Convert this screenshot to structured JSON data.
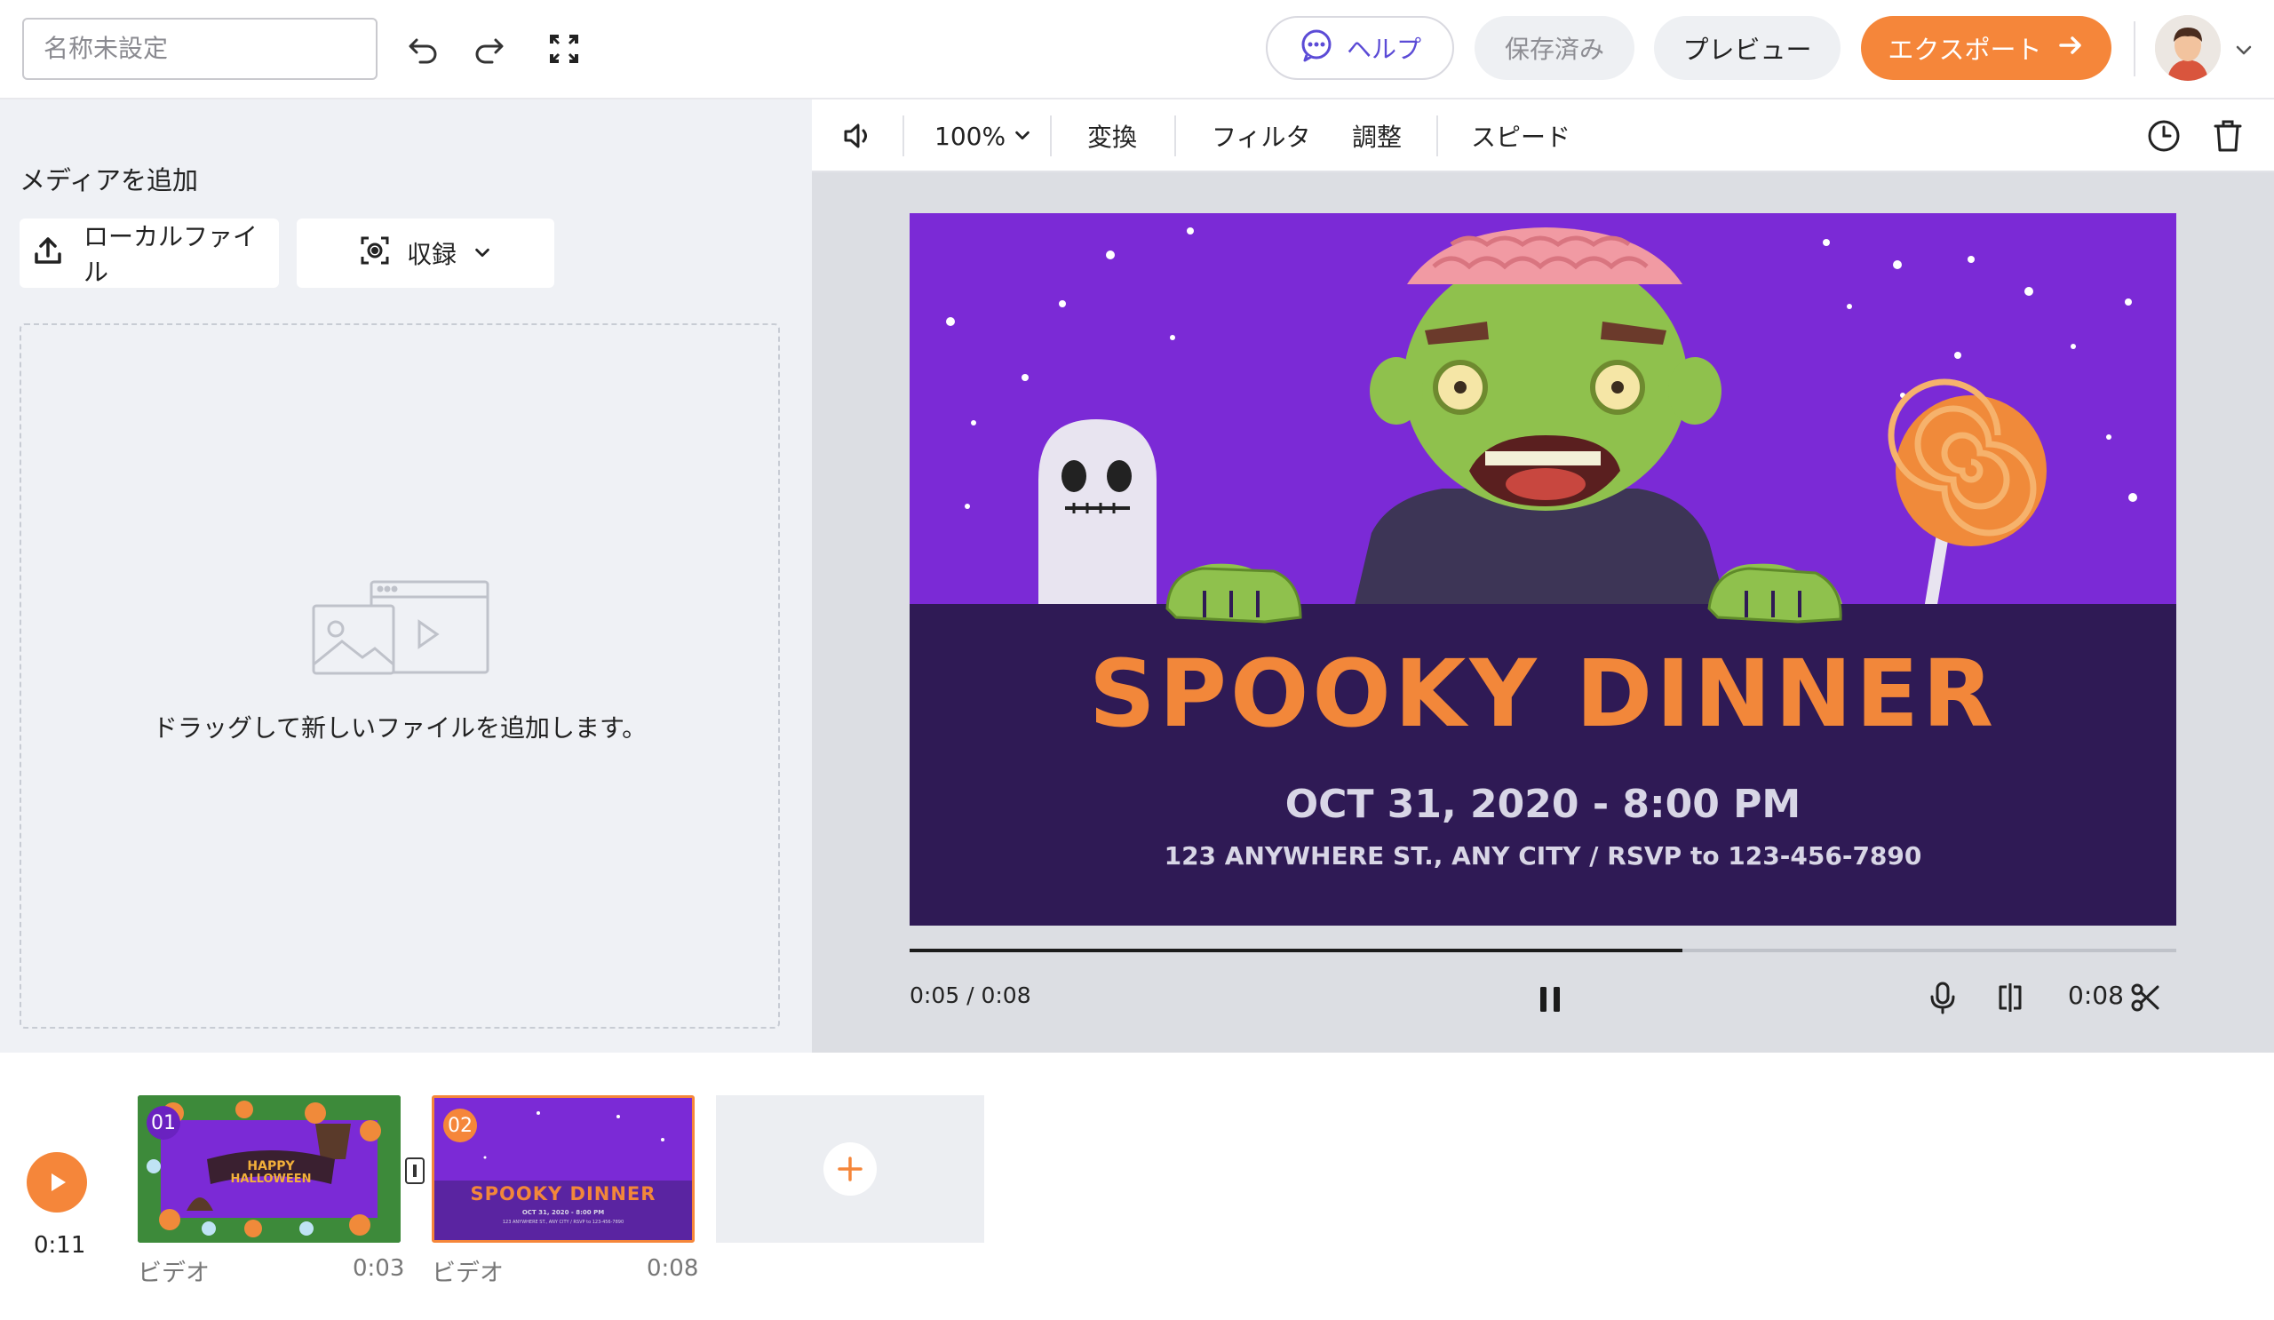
{
  "topbar": {
    "project_name_placeholder": "名称未設定",
    "help_label": "ヘルプ",
    "saved_label": "保存済み",
    "preview_label": "プレビュー",
    "export_label": "エクスポート"
  },
  "media_panel": {
    "title": "メディアを追加",
    "local_file_label": "ローカルファイル",
    "record_label": "収録",
    "drop_hint": "ドラッグして新しいファイルを追加します。"
  },
  "preview_toolbar": {
    "zoom": "100%",
    "transform": "変換",
    "filter": "フィルタ",
    "adjust": "調整",
    "speed": "スピード"
  },
  "canvas": {
    "title": "Spooky Dinner",
    "date_line": "OCT 31, 2020  -  8:00 PM",
    "address_line": "123 ANYWHERE ST., ANY CITY  / RSVP to 123-456-7890"
  },
  "playback": {
    "current_time": "0:05 / 0:08",
    "progress_fraction": 0.61,
    "duration": "0:08"
  },
  "timeline": {
    "total_time": "0:11",
    "clips": [
      {
        "number": "01",
        "label": "ビデオ",
        "duration": "0:03",
        "caption": "HAPPY HALLOWEEN"
      },
      {
        "number": "02",
        "label": "ビデオ",
        "duration": "0:08",
        "caption": "Spooky Dinner"
      }
    ]
  },
  "colors": {
    "accent_orange": "#f5863a",
    "help_purple": "#5b4bd6",
    "poster_purple": "#7b2ad6",
    "poster_dark": "#2f1a55"
  },
  "icons": [
    "undo-icon",
    "redo-icon",
    "fullscreen-icon",
    "chat-icon",
    "arrow-right-icon",
    "chevron-down-icon",
    "upload-icon",
    "record-icon",
    "media-placeholder-icon",
    "chevron-left-icon",
    "volume-icon",
    "history-icon",
    "trash-icon",
    "pause-icon",
    "mic-icon",
    "split-icon",
    "scissors-icon",
    "play-icon",
    "plus-icon",
    "transition-icon"
  ]
}
